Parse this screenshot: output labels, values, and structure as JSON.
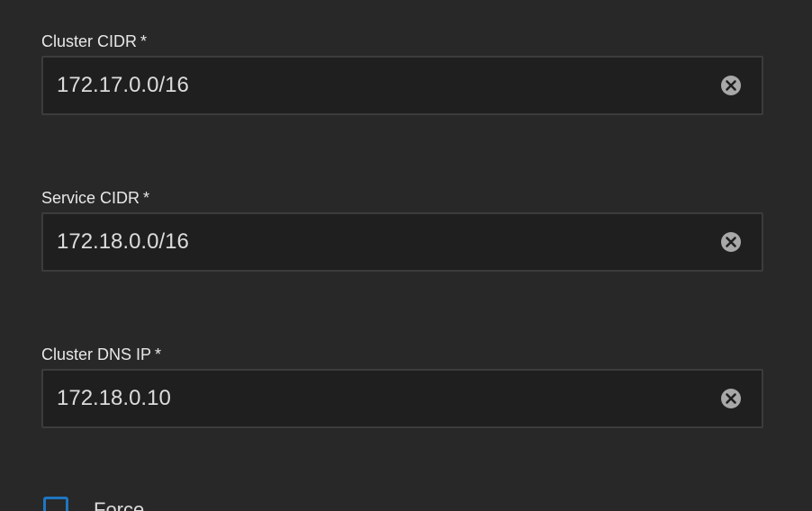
{
  "fields": [
    {
      "label": "Cluster CIDR",
      "required_mark": "*",
      "value": "172.17.0.0/16",
      "clear_icon": "clear-circle-x-icon"
    },
    {
      "label": "Service CIDR",
      "required_mark": "*",
      "value": "172.18.0.0/16",
      "clear_icon": "clear-circle-x-icon"
    },
    {
      "label": "Cluster DNS IP",
      "required_mark": "*",
      "value": "172.18.0.10",
      "clear_icon": "clear-circle-x-icon"
    }
  ],
  "force": {
    "label": "Force",
    "checked": false
  },
  "colors": {
    "background": "#282828",
    "input_background": "#1f1f1f",
    "input_border": "#3c3c3c",
    "checkbox_border": "#1f76c2",
    "clear_icon": "#a8a8a8"
  }
}
